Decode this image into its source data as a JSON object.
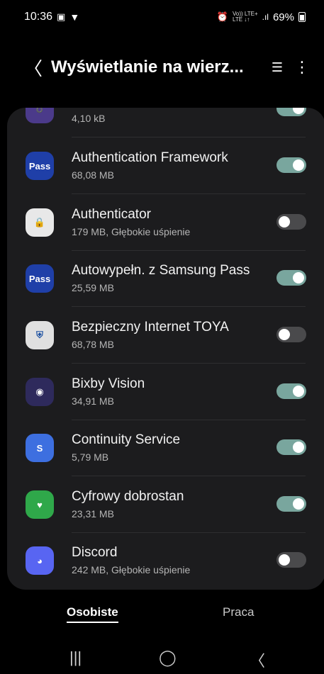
{
  "status": {
    "time": "10:36",
    "battery": "69%",
    "net_top": "Vo)) LTE+",
    "net_bottom": "LTE ↓↑"
  },
  "header": {
    "back": "〈",
    "title": "Wyświetlanie na wierz...",
    "filter_icon": "☰",
    "more_icon": "⋮"
  },
  "apps": [
    {
      "name": "",
      "size": "4,10 kB",
      "on": true,
      "icon": "swirl",
      "color": "#4b3a8a",
      "icon_text": "➰"
    },
    {
      "name": "Authentication Framework",
      "size": "68,08 MB",
      "on": true,
      "icon": "samsung-pass",
      "color": "#1f3fa8",
      "icon_text": "Pass"
    },
    {
      "name": "Authenticator",
      "size": "179 MB, Głębokie uśpienie",
      "on": false,
      "icon": "authenticator",
      "color": "#e8e8e8",
      "icon_text": "🔒"
    },
    {
      "name": "Autowypełn. z Samsung Pass",
      "size": "25,59 MB",
      "on": true,
      "icon": "samsung-pass",
      "color": "#1f3fa8",
      "icon_text": "Pass"
    },
    {
      "name": "Bezpieczny Internet TOYA",
      "size": "68,78 MB",
      "on": false,
      "icon": "shield",
      "color": "#e0e0e0",
      "icon_text": "⛨"
    },
    {
      "name": "Bixby Vision",
      "size": "34,91 MB",
      "on": true,
      "icon": "eye",
      "color": "#2e2a5c",
      "icon_text": "◉"
    },
    {
      "name": "Continuity Service",
      "size": "5,79 MB",
      "on": true,
      "icon": "continuity",
      "color": "#3d6fe0",
      "icon_text": "S"
    },
    {
      "name": "Cyfrowy dobrostan",
      "size": "23,31 MB",
      "on": true,
      "icon": "heart",
      "color": "#2fa84a",
      "icon_text": "♥"
    },
    {
      "name": "Discord",
      "size": "242 MB, Głębokie uśpienie",
      "on": false,
      "icon": "discord",
      "color": "#5865f2",
      "icon_text": "◕"
    }
  ],
  "tabs": {
    "active": "Osobiste",
    "inactive": "Praca"
  },
  "nav": {
    "recents": "|||",
    "home": "◯",
    "back": "〈"
  }
}
